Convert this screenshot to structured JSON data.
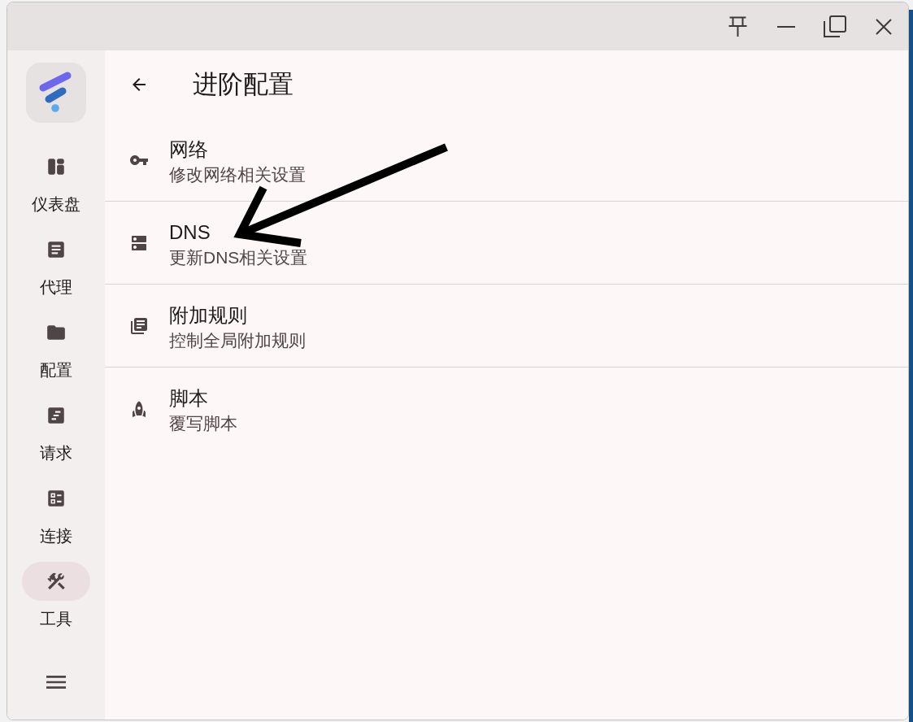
{
  "sidebar": {
    "items": [
      {
        "label": "仪表盘",
        "selected": false
      },
      {
        "label": "代理",
        "selected": false
      },
      {
        "label": "配置",
        "selected": false
      },
      {
        "label": "请求",
        "selected": false
      },
      {
        "label": "连接",
        "selected": false
      },
      {
        "label": "工具",
        "selected": true
      }
    ]
  },
  "page": {
    "title": "进阶配置",
    "items": [
      {
        "title": "网络",
        "subtitle": "修改网络相关设置",
        "annotated": false
      },
      {
        "title": "DNS",
        "subtitle": "更新DNS相关设置",
        "annotated": true
      },
      {
        "title": "附加规则",
        "subtitle": "控制全局附加规则",
        "annotated": false
      },
      {
        "title": "脚本",
        "subtitle": "覆写脚本",
        "annotated": false
      }
    ]
  }
}
